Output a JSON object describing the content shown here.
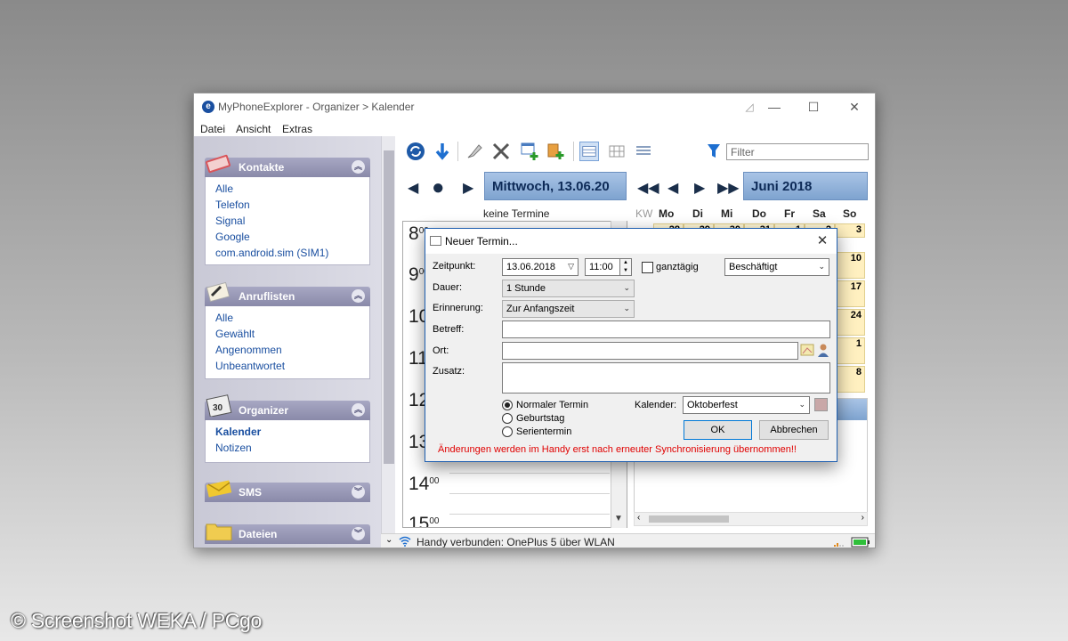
{
  "window": {
    "app_name": "MyPhoneExplorer -",
    "path": "Organizer > Kalender",
    "controls": {
      "min": "—",
      "max": "☐",
      "close": "✕"
    }
  },
  "menu": [
    "Datei",
    "Ansicht",
    "Extras"
  ],
  "sidebar": {
    "kontakte": {
      "title": "Kontakte",
      "items": [
        "Alle",
        "Telefon",
        "Signal",
        "Google",
        "com.android.sim (SIM1)"
      ]
    },
    "anruflisten": {
      "title": "Anruflisten",
      "items": [
        "Alle",
        "Gewählt",
        "Angenommen",
        "Unbeantwortet"
      ]
    },
    "organizer": {
      "title": "Organizer",
      "items": [
        "Kalender",
        "Notizen"
      ],
      "active": "Kalender"
    },
    "sms": {
      "title": "SMS"
    },
    "dateien": {
      "title": "Dateien"
    }
  },
  "toolbar": {
    "filter_placeholder": "Filter"
  },
  "calendar": {
    "day_header": "Mittwoch, 13.06.20",
    "month_header": "Juni 2018",
    "no_events": "keine Termine",
    "hours": [
      "8",
      "9",
      "10",
      "11",
      "12",
      "13",
      "14",
      "15"
    ],
    "minutes": "00",
    "weekday_headers": [
      "KW",
      "Mo",
      "Di",
      "Mi",
      "Do",
      "Fr",
      "Sa",
      "So"
    ],
    "first_row": [
      "28",
      "29",
      "30",
      "31",
      "1",
      "2",
      "3"
    ],
    "sunday_visible": [
      "10",
      "17",
      "24",
      "1",
      "8"
    ]
  },
  "status": {
    "text": "Handy verbunden: OnePlus 5 über WLAN"
  },
  "dialog": {
    "title": "Neuer Termin...",
    "close": "✕",
    "labels": {
      "zeitpunkt": "Zeitpunkt:",
      "dauer": "Dauer:",
      "erinnerung": "Erinnerung:",
      "betreff": "Betreff:",
      "ort": "Ort:",
      "zusatz": "Zusatz:",
      "kalender": "Kalender:",
      "ganztaegig": "ganztägig"
    },
    "values": {
      "date": "13.06.2018",
      "time": "11:00",
      "status": "Beschäftigt",
      "dauer": "1 Stunde",
      "erinnerung": "Zur Anfangszeit",
      "betreff": "",
      "ort": "",
      "zusatz": "",
      "kalender": "Oktoberfest"
    },
    "radio": [
      "Normaler Termin",
      "Geburtstag",
      "Serientermin"
    ],
    "radio_selected": 0,
    "ok": "OK",
    "cancel": "Abbrechen",
    "warning": "Änderungen werden im Handy erst nach erneuter Synchronisierung übernommen!!"
  },
  "watermark": "© Screenshot WEKA / PCgo",
  "colors": {
    "accent_blue": "#1a4fa0",
    "header_blue": "#7ea3cf",
    "warning_red": "#e00000",
    "calendar_cell": "#fff7d6"
  }
}
